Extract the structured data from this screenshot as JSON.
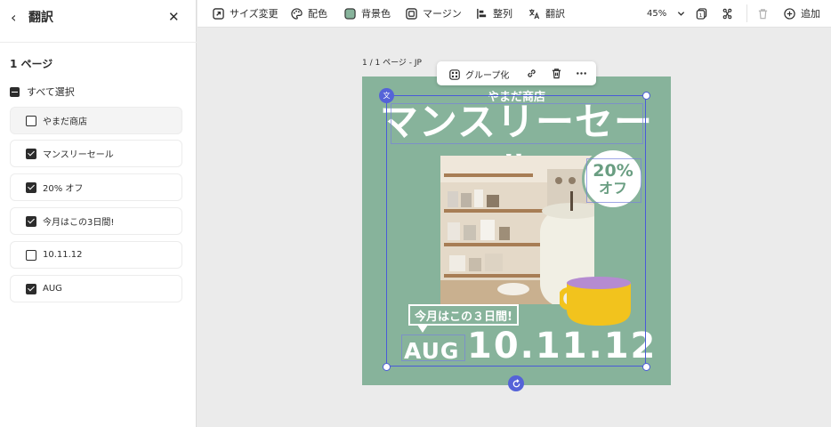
{
  "sidebar": {
    "title": "翻訳",
    "section_title": "1 ページ",
    "select_all_label": "すべて選択",
    "items": [
      {
        "label": "やまだ商店",
        "checked": false
      },
      {
        "label": "マンスリーセール",
        "checked": true
      },
      {
        "label": "20% オフ",
        "checked": true
      },
      {
        "label": "今月はこの3日間!",
        "checked": true
      },
      {
        "label": "10.11.12",
        "checked": false
      },
      {
        "label": "AUG",
        "checked": true
      }
    ]
  },
  "toolbar": {
    "resize_label": "サイズ変更",
    "color_label": "配色",
    "background_label": "背景色",
    "margin_label": "マージン",
    "align_label": "整列",
    "translate_label": "翻訳",
    "zoom": "45%",
    "add_label": "追加"
  },
  "canvas": {
    "page_label": "1 / 1 ページ - JP",
    "context_menu": {
      "group_label": "グループ化"
    }
  },
  "design": {
    "shop_name": "やまだ商店",
    "headline": "マンスリーセール",
    "badge_line1": "20%",
    "badge_line2": "オフ",
    "bubble_text": "今月はこの３日間!",
    "month": "AUG",
    "dates": "10.11.12",
    "background_color": "#87b39b"
  },
  "colors": {
    "selection": "#4a5bd8",
    "accent_text": "#2c2c2c"
  }
}
